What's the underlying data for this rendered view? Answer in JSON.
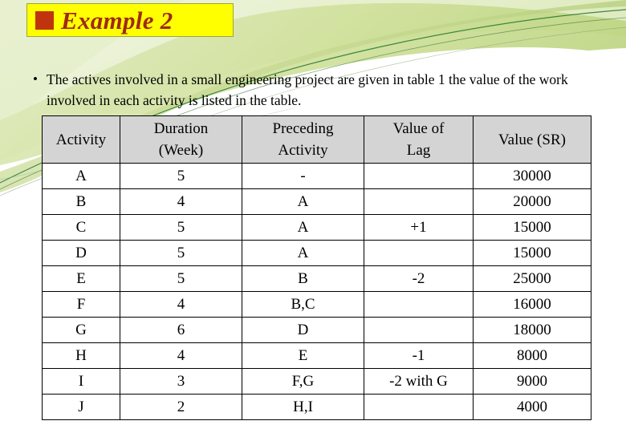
{
  "slide": {
    "title": "Example 2",
    "title_bullet_icon": "red-square-bullet",
    "body_bullet_marker": "•",
    "body_text": "The actives involved in a small engineering project are given in table 1 the value of the work involved in each activity is listed in the table."
  },
  "colors": {
    "title_background": "#ffff00",
    "title_border": "#9aa832",
    "title_text": "#9e2a14",
    "title_bullet": "#c0330f",
    "table_header_background": "#d4d4d4",
    "table_border": "#000000",
    "accent_green_dark": "#2e7d32",
    "accent_green_mid": "#b5c96a",
    "accent_green_light": "#d9e6b0",
    "accent_green_pale": "#eef3dd"
  },
  "table": {
    "headers": [
      {
        "line1": "Activity",
        "line2": ""
      },
      {
        "line1": "Duration",
        "line2": "(Week)"
      },
      {
        "line1": "Preceding",
        "line2": "Activity"
      },
      {
        "line1": "Value of",
        "line2": "Lag"
      },
      {
        "line1": "Value (SR)",
        "line2": ""
      }
    ],
    "rows": [
      {
        "activity": "A",
        "duration": "5",
        "preceding": "-",
        "lag": "",
        "value": "30000"
      },
      {
        "activity": "B",
        "duration": "4",
        "preceding": "A",
        "lag": "",
        "value": "20000"
      },
      {
        "activity": "C",
        "duration": "5",
        "preceding": "A",
        "lag": "+1",
        "value": "15000"
      },
      {
        "activity": "D",
        "duration": "5",
        "preceding": "A",
        "lag": "",
        "value": "15000"
      },
      {
        "activity": "E",
        "duration": "5",
        "preceding": "B",
        "lag": "-2",
        "value": "25000"
      },
      {
        "activity": "F",
        "duration": "4",
        "preceding": "B,C",
        "lag": "",
        "value": "16000"
      },
      {
        "activity": "G",
        "duration": "6",
        "preceding": "D",
        "lag": "",
        "value": "18000"
      },
      {
        "activity": "H",
        "duration": "4",
        "preceding": "E",
        "lag": "-1",
        "value": "8000"
      },
      {
        "activity": "I",
        "duration": "3",
        "preceding": "F,G",
        "lag": "-2 with G",
        "value": "9000"
      },
      {
        "activity": "J",
        "duration": "2",
        "preceding": "H,I",
        "lag": "",
        "value": "4000"
      }
    ]
  }
}
